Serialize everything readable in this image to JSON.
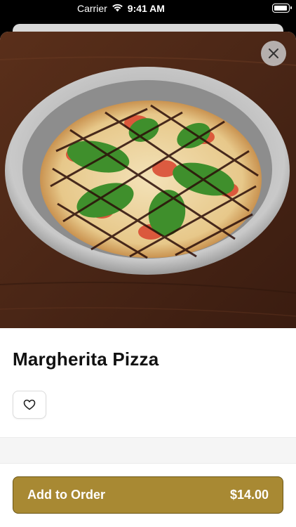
{
  "status_bar": {
    "carrier": "Carrier",
    "time": "9:41 AM",
    "icons": [
      "wifi-icon",
      "battery-icon"
    ]
  },
  "item": {
    "name": "Margherita Pizza"
  },
  "actions": {
    "close_icon": "close-icon",
    "favorite_icon": "heart-icon"
  },
  "cart": {
    "add_label": "Add to Order",
    "price": "$14.00"
  },
  "colors": {
    "accent": "#a88933",
    "accent_border": "#6b5616"
  }
}
